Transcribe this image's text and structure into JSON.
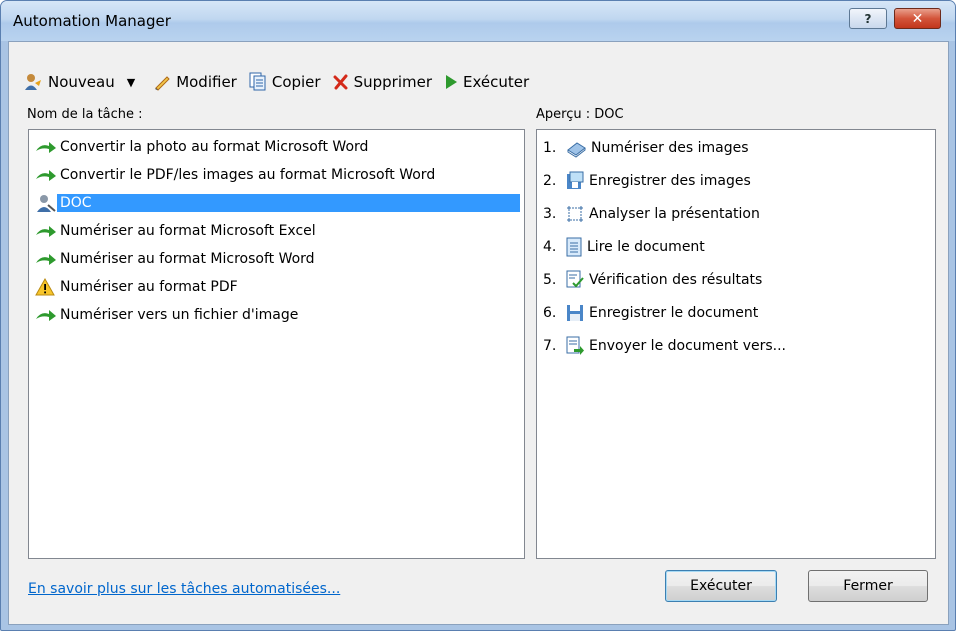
{
  "window": {
    "title": "Automation Manager",
    "help_label": "?",
    "close_label": "✕"
  },
  "toolbar": {
    "new_label": "Nouveau",
    "modify_label": "Modifier",
    "copy_label": "Copier",
    "delete_label": "Supprimer",
    "run_label": "Exécuter"
  },
  "tasks": {
    "header": "Nom de la tâche :",
    "items": [
      {
        "label": "Convertir la photo au format Microsoft Word",
        "icon": "green-arrow-icon"
      },
      {
        "label": "Convertir le PDF/les images au format Microsoft Word",
        "icon": "green-arrow-icon"
      },
      {
        "label": "DOC",
        "icon": "user-task-icon",
        "selected": true
      },
      {
        "label": "Numériser au format Microsoft Excel",
        "icon": "green-arrow-icon"
      },
      {
        "label": "Numériser au format Microsoft Word",
        "icon": "green-arrow-icon"
      },
      {
        "label": "Numériser au format PDF",
        "icon": "warning-icon"
      },
      {
        "label": "Numériser vers un fichier d'image",
        "icon": "green-arrow-icon"
      }
    ]
  },
  "preview": {
    "header": "Aperçu : DOC",
    "steps": [
      {
        "num": "1.",
        "label": "Numériser des images",
        "icon": "scanner-icon"
      },
      {
        "num": "2.",
        "label": "Enregistrer des images",
        "icon": "save-images-icon"
      },
      {
        "num": "3.",
        "label": "Analyser la présentation",
        "icon": "layout-analysis-icon"
      },
      {
        "num": "4.",
        "label": "Lire le document",
        "icon": "read-document-icon"
      },
      {
        "num": "5.",
        "label": "Vérification des résultats",
        "icon": "verify-icon"
      },
      {
        "num": "6.",
        "label": "Enregistrer le document",
        "icon": "save-document-icon"
      },
      {
        "num": "7.",
        "label": "Envoyer le document vers...",
        "icon": "send-document-icon"
      }
    ]
  },
  "footer": {
    "link": "En savoir plus sur les tâches automatisées...",
    "run_button": "Exécuter",
    "close_button": "Fermer"
  },
  "colors": {
    "selection": "#3399ff",
    "link": "#0066cc",
    "accent_green": "#2e9a2e",
    "delete_red": "#d42a1a"
  }
}
